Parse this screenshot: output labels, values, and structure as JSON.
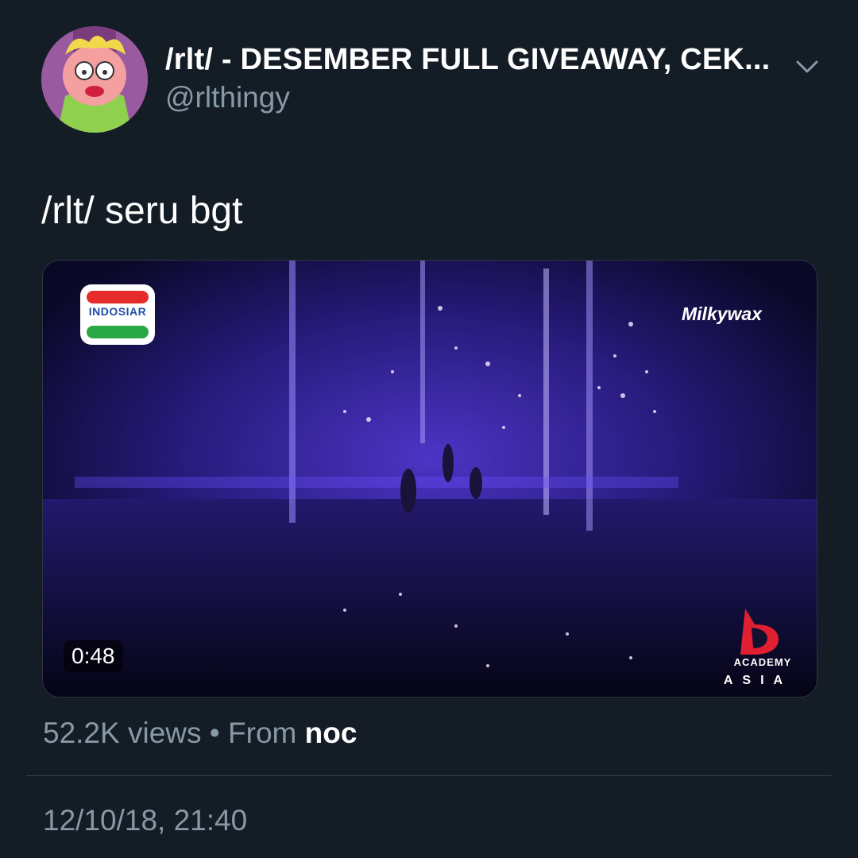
{
  "tweet": {
    "display_name": "/rlt/ - DESEMBER FULL GIVEAWAY, CEK...",
    "handle": "@rlthingy",
    "text": "/rlt/ seru bgt",
    "timestamp": "12/10/18, 21:40"
  },
  "media": {
    "duration": "0:48",
    "channel_logo_text": "INDOSIAR",
    "watermark": "Milkywax",
    "show_logo_line1": "ACADEMY",
    "show_logo_line2": "ASIA"
  },
  "stats": {
    "views": "52.2K views",
    "separator": "•",
    "from_label": "From",
    "source": "noc"
  },
  "icons": {
    "menu": "chevron-down-icon",
    "avatar": "cartoon-avatar"
  },
  "colors": {
    "background": "#141d26",
    "secondary_text": "#8899a6",
    "divider": "#38444d",
    "stage_purple": "#3a2aa8"
  }
}
